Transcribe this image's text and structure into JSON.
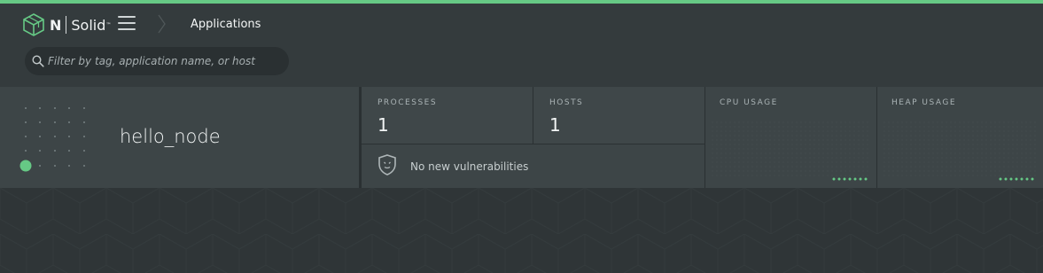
{
  "header": {
    "logo_letter": "N",
    "logo_word": "Solid",
    "logo_tm": "™",
    "breadcrumb": "Applications"
  },
  "search": {
    "placeholder": "Filter by tag, application name, or host",
    "value": ""
  },
  "application": {
    "name": "hello_node",
    "processes_label": "PROCESSES",
    "processes_value": "1",
    "hosts_label": "HOSTS",
    "hosts_value": "1",
    "vulnerabilities_text": "No new vulnerabilities",
    "cpu_label": "CPU USAGE",
    "heap_label": "HEAP USAGE"
  },
  "colors": {
    "accent": "#66c985",
    "status_dot": "#66c985",
    "panel": "#3d4547",
    "header": "#343b3d",
    "background": "#2e3436"
  },
  "icons": {
    "logo": "nsolid-cube-icon",
    "menu": "hamburger-menu-icon",
    "breadcrumb_separator": "chevron-right-icon",
    "search": "search-icon",
    "vulnerabilities": "shield-icon"
  }
}
